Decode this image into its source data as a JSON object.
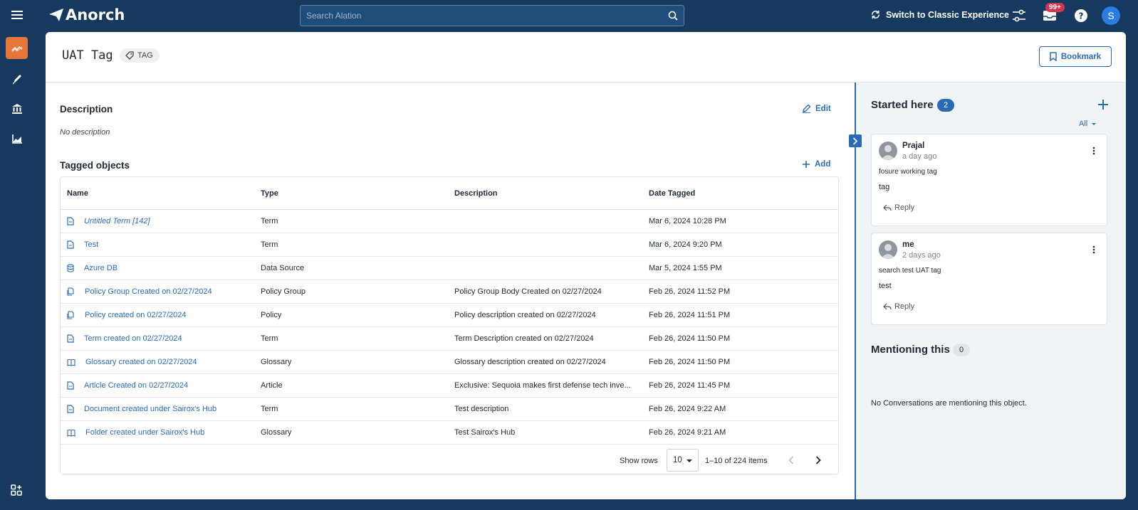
{
  "app": {
    "brand": "Anorch",
    "search_placeholder": "Search Alation",
    "switch_label": "Switch to Classic Experience",
    "notification_badge": "99+",
    "user_initial": "S"
  },
  "colors": {
    "topbar": "#163a5f",
    "accent": "#2a6bb8",
    "nav_active": "#e6753a",
    "badge": "#d6334f"
  },
  "nav": {
    "items": [
      "trend-icon",
      "pen-icon",
      "bank-icon",
      "chart-icon"
    ],
    "bottom": "apps-icon"
  },
  "page": {
    "title": "UAT Tag",
    "type_label": "TAG",
    "bookmark_label": "Bookmark"
  },
  "description": {
    "title": "Description",
    "edit_label": "Edit",
    "empty_text": "No description"
  },
  "tagged": {
    "title": "Tagged objects",
    "add_label": "Add",
    "columns": [
      "Name",
      "Type",
      "Description",
      "Date Tagged"
    ],
    "rows": [
      {
        "name": "Untitled Term [142]",
        "icon": "document-icon",
        "italic": true,
        "type": "Term",
        "description": "",
        "date": "Mar 6, 2024 10:28 PM"
      },
      {
        "name": "Test",
        "icon": "document-icon",
        "italic": false,
        "type": "Term",
        "description": "",
        "date": "Mar 6, 2024 9:20 PM"
      },
      {
        "name": "Azure DB",
        "icon": "database-icon",
        "italic": false,
        "type": "Data Source",
        "description": "",
        "date": "Mar 5, 2024 1:55 PM"
      },
      {
        "name": "Policy Group Created on 02/27/2024",
        "icon": "policy-group-icon",
        "italic": false,
        "type": "Policy Group",
        "description": "Policy Group Body Created on 02/27/2024",
        "date": "Feb 26, 2024 11:52 PM"
      },
      {
        "name": "Policy created on 02/27/2024",
        "icon": "policy-icon",
        "italic": false,
        "type": "Policy",
        "description": "Policy description created on 02/27/2024",
        "date": "Feb 26, 2024 11:51 PM"
      },
      {
        "name": "Term created on 02/27/2024",
        "icon": "document-icon",
        "italic": false,
        "type": "Term",
        "description": "Term Description created on 02/27/2024",
        "date": "Feb 26, 2024 11:50 PM"
      },
      {
        "name": "Glossary created on 02/27/2024",
        "icon": "book-icon",
        "italic": false,
        "type": "Glossary",
        "description": "Glossary description created on 02/27/2024",
        "date": "Feb 26, 2024 11:50 PM"
      },
      {
        "name": "Article Created on 02/27/2024",
        "icon": "document-icon",
        "italic": false,
        "type": "Article",
        "description": "Exclusive: Sequoia makes first defense tech inve...",
        "date": "Feb 26, 2024 11:45 PM"
      },
      {
        "name": "Document created under Sairox's Hub",
        "icon": "document-icon",
        "italic": false,
        "type": "Term",
        "description": "Test description",
        "date": "Feb 26, 2024 9:22 AM"
      },
      {
        "name": "Folder created under Sairox's Hub",
        "icon": "book-icon",
        "italic": false,
        "type": "Glossary",
        "description": "Test Sairox's Hub",
        "date": "Feb 26, 2024 9:21 AM"
      }
    ],
    "show_rows_label": "Show rows",
    "rows_per_page": "10",
    "page_info": "1–10 of 224 items"
  },
  "sidebar": {
    "started_title": "Started here",
    "started_count": "2",
    "filter_label": "All",
    "conversations": [
      {
        "user": "Prajal",
        "time": "a day ago",
        "line1": "fosure working tag",
        "line2": "tag",
        "reply_label": "Reply"
      },
      {
        "user": "me",
        "time": "2 days ago",
        "line1": "search test UAT tag",
        "line2": "test",
        "reply_label": "Reply"
      }
    ],
    "mention_title": "Mentioning this",
    "mention_count": "0",
    "mention_empty": "No Conversations are mentioning this object."
  }
}
